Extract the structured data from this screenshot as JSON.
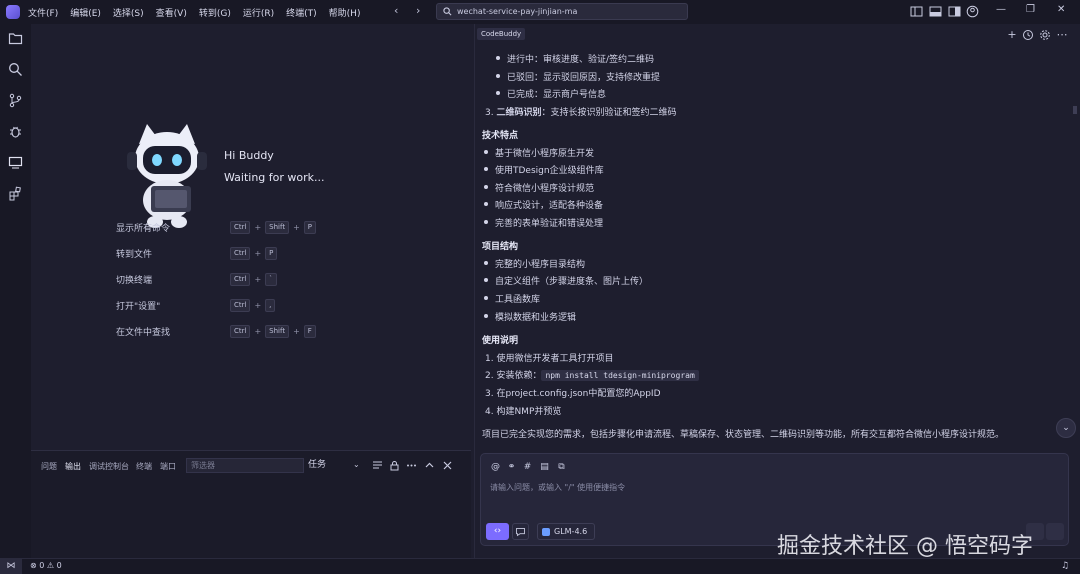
{
  "menu": [
    "文件(F)",
    "编辑(E)",
    "选择(S)",
    "查看(V)",
    "转到(G)",
    "运行(R)",
    "终端(T)",
    "帮助(H)"
  ],
  "search": {
    "value": "wechat-service-pay-jinjian-ma"
  },
  "welcome": {
    "greeting": "Hi Buddy",
    "status": "Waiting for work...",
    "commands": [
      {
        "label": "显示所有命令",
        "keys": [
          "Ctrl",
          "Shift",
          "P"
        ]
      },
      {
        "label": "转到文件",
        "keys": [
          "Ctrl",
          "P"
        ]
      },
      {
        "label": "切换终端",
        "keys": [
          "Ctrl",
          "`"
        ]
      },
      {
        "label": "打开\"设置\"",
        "keys": [
          "Ctrl",
          ","
        ]
      },
      {
        "label": "在文件中查找",
        "keys": [
          "Ctrl",
          "Shift",
          "F"
        ]
      }
    ]
  },
  "panel": {
    "tabs": [
      "问题",
      "输出",
      "调试控制台",
      "终端",
      "端口"
    ],
    "active_tab": "输出",
    "filter_placeholder": "筛选器",
    "task_select": "任务"
  },
  "chat": {
    "tag": "CodeBuddy",
    "sub_bullets": [
      "进行中：审核进度、验证/签约二维码",
      "已驳回：显示驳回原因，支持修改重提",
      "已完成：显示商户号信息"
    ],
    "item3_label": "3.",
    "item3_bold": "二维码识别",
    "item3_rest": "：支持长按识别验证和签约二维码",
    "sections": [
      {
        "title": "技术特点",
        "items": [
          "基于微信小程序原生开发",
          "使用TDesign企业级组件库",
          "符合微信小程序设计规范",
          "响应式设计，适配各种设备",
          "完善的表单验证和错误处理"
        ]
      },
      {
        "title": "项目结构",
        "items": [
          "完整的小程序目录结构",
          "自定义组件（步骤进度条、图片上传）",
          "工具函数库",
          "模拟数据和业务逻辑"
        ]
      }
    ],
    "usage_title": "使用说明",
    "usage": {
      "step1": "1. 使用微信开发者工具打开项目",
      "step2_prefix": "2. 安装依赖：",
      "step2_code": "npm install tdesign-miniprogram",
      "step3": "3. 在project.config.json中配置您的AppID",
      "step4": "4. 构建NMP并预览"
    },
    "summary": "项目已完全实现您的需求，包括步骤化申请流程、草稿保存、状态管理、二维码识别等功能，所有交互都符合微信小程序设计规范。",
    "input_placeholder": "请输入问题，或输入 \"/\" 使用便捷指令",
    "model": "GLM-4.6"
  },
  "watermark": "掘金技术社区 @ 悟空码字",
  "status": {
    "errors": "0",
    "warnings": "0"
  },
  "colors": {
    "accent": "#7c6cff",
    "background": "#1e1e2e",
    "chrome": "#181825"
  }
}
